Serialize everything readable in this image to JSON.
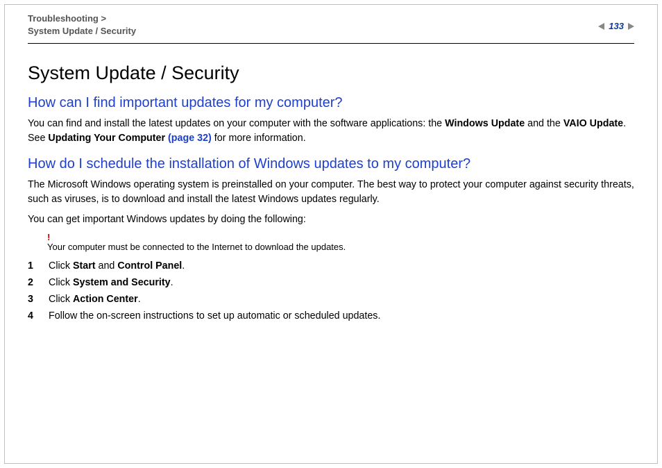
{
  "breadcrumb": {
    "line1": "Troubleshooting",
    "line2": "System Update / Security"
  },
  "page_number": "133",
  "title": "System Update / Security",
  "section1": {
    "heading": "How can I find important updates for my computer?",
    "para_pre": "You can find and install the latest updates on your computer with the software applications: the ",
    "bold1": "Windows Update",
    "mid1": " and the ",
    "bold2": "VAIO Update",
    "mid2": ". See ",
    "bold3": "Updating Your Computer ",
    "xref": "(page 32)",
    "tail": " for more information."
  },
  "section2": {
    "heading": "How do I schedule the installation of Windows updates to my computer?",
    "para1": "The Microsoft Windows operating system is preinstalled on your computer. The best way to protect your computer against security threats, such as viruses, is to download and install the latest Windows updates regularly.",
    "para2": "You can get important Windows updates by doing the following:",
    "warn_mark": "!",
    "warn_text": "Your computer must be connected to the Internet to download the updates.",
    "steps": [
      {
        "pre": "Click ",
        "b1": "Start",
        "mid": " and ",
        "b2": "Control Panel",
        "post": "."
      },
      {
        "pre": "Click ",
        "b1": "System and Security",
        "post": "."
      },
      {
        "pre": "Click ",
        "b1": "Action Center",
        "post": "."
      },
      {
        "pre": "Follow the on-screen instructions to set up automatic or scheduled updates."
      }
    ]
  }
}
